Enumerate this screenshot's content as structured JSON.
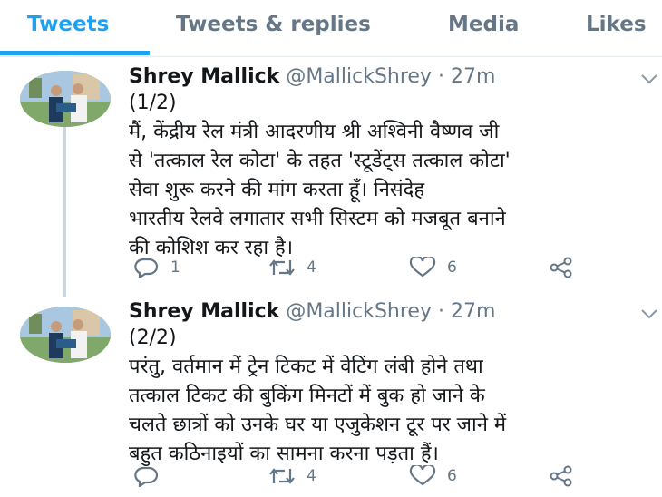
{
  "tabs": [
    {
      "label": "Tweets"
    },
    {
      "label": "Tweets & replies"
    },
    {
      "label": "Media"
    },
    {
      "label": "Likes"
    }
  ],
  "tweets": [
    {
      "name": "Shrey Mallick",
      "handle": "@MallickShrey",
      "time": "· 27m",
      "lines": [
        "(1/2)",
        "मैं, केंद्रीय रेल मंत्री आदरणीय श्री अश्विनी वैष्णव जी",
        "से 'तत्काल रेल कोटा' के तहत 'स्टूडेंट्स तत्काल कोटा'",
        "सेवा शुरू करने की मांग करता हूँ। निसंदेह",
        "भारतीय रेलवे लगातार सभी सिस्टम को मजबूत बनाने",
        "की कोशिश कर रहा है।"
      ],
      "replies": "1",
      "retweets": "4",
      "likes": "6"
    },
    {
      "name": "Shrey Mallick",
      "handle": "@MallickShrey",
      "time": "· 27m",
      "lines": [
        "(2/2)",
        "परंतु, वर्तमान में ट्रेन टिकट में वेटिंग लंबी होने तथा",
        "तत्काल टिकट की बुकिंग मिनटों में बुक हो जाने के",
        "चलते छात्रों को उनके घर या एजुकेशन टूर पर जाने में",
        "बहुत कठिनाइयों का सामना करना पड़ता हैं।"
      ],
      "replies": "",
      "retweets": "4",
      "likes": "6"
    }
  ],
  "icons": {
    "reply": "reply-icon",
    "retweet": "retweet-icon",
    "like": "heart-icon",
    "share": "share-icon",
    "caret": "chevron-down-icon"
  },
  "colors": {
    "accent": "#1da1f2",
    "secondary_text": "#657786",
    "divider": "#e6ecf0"
  }
}
